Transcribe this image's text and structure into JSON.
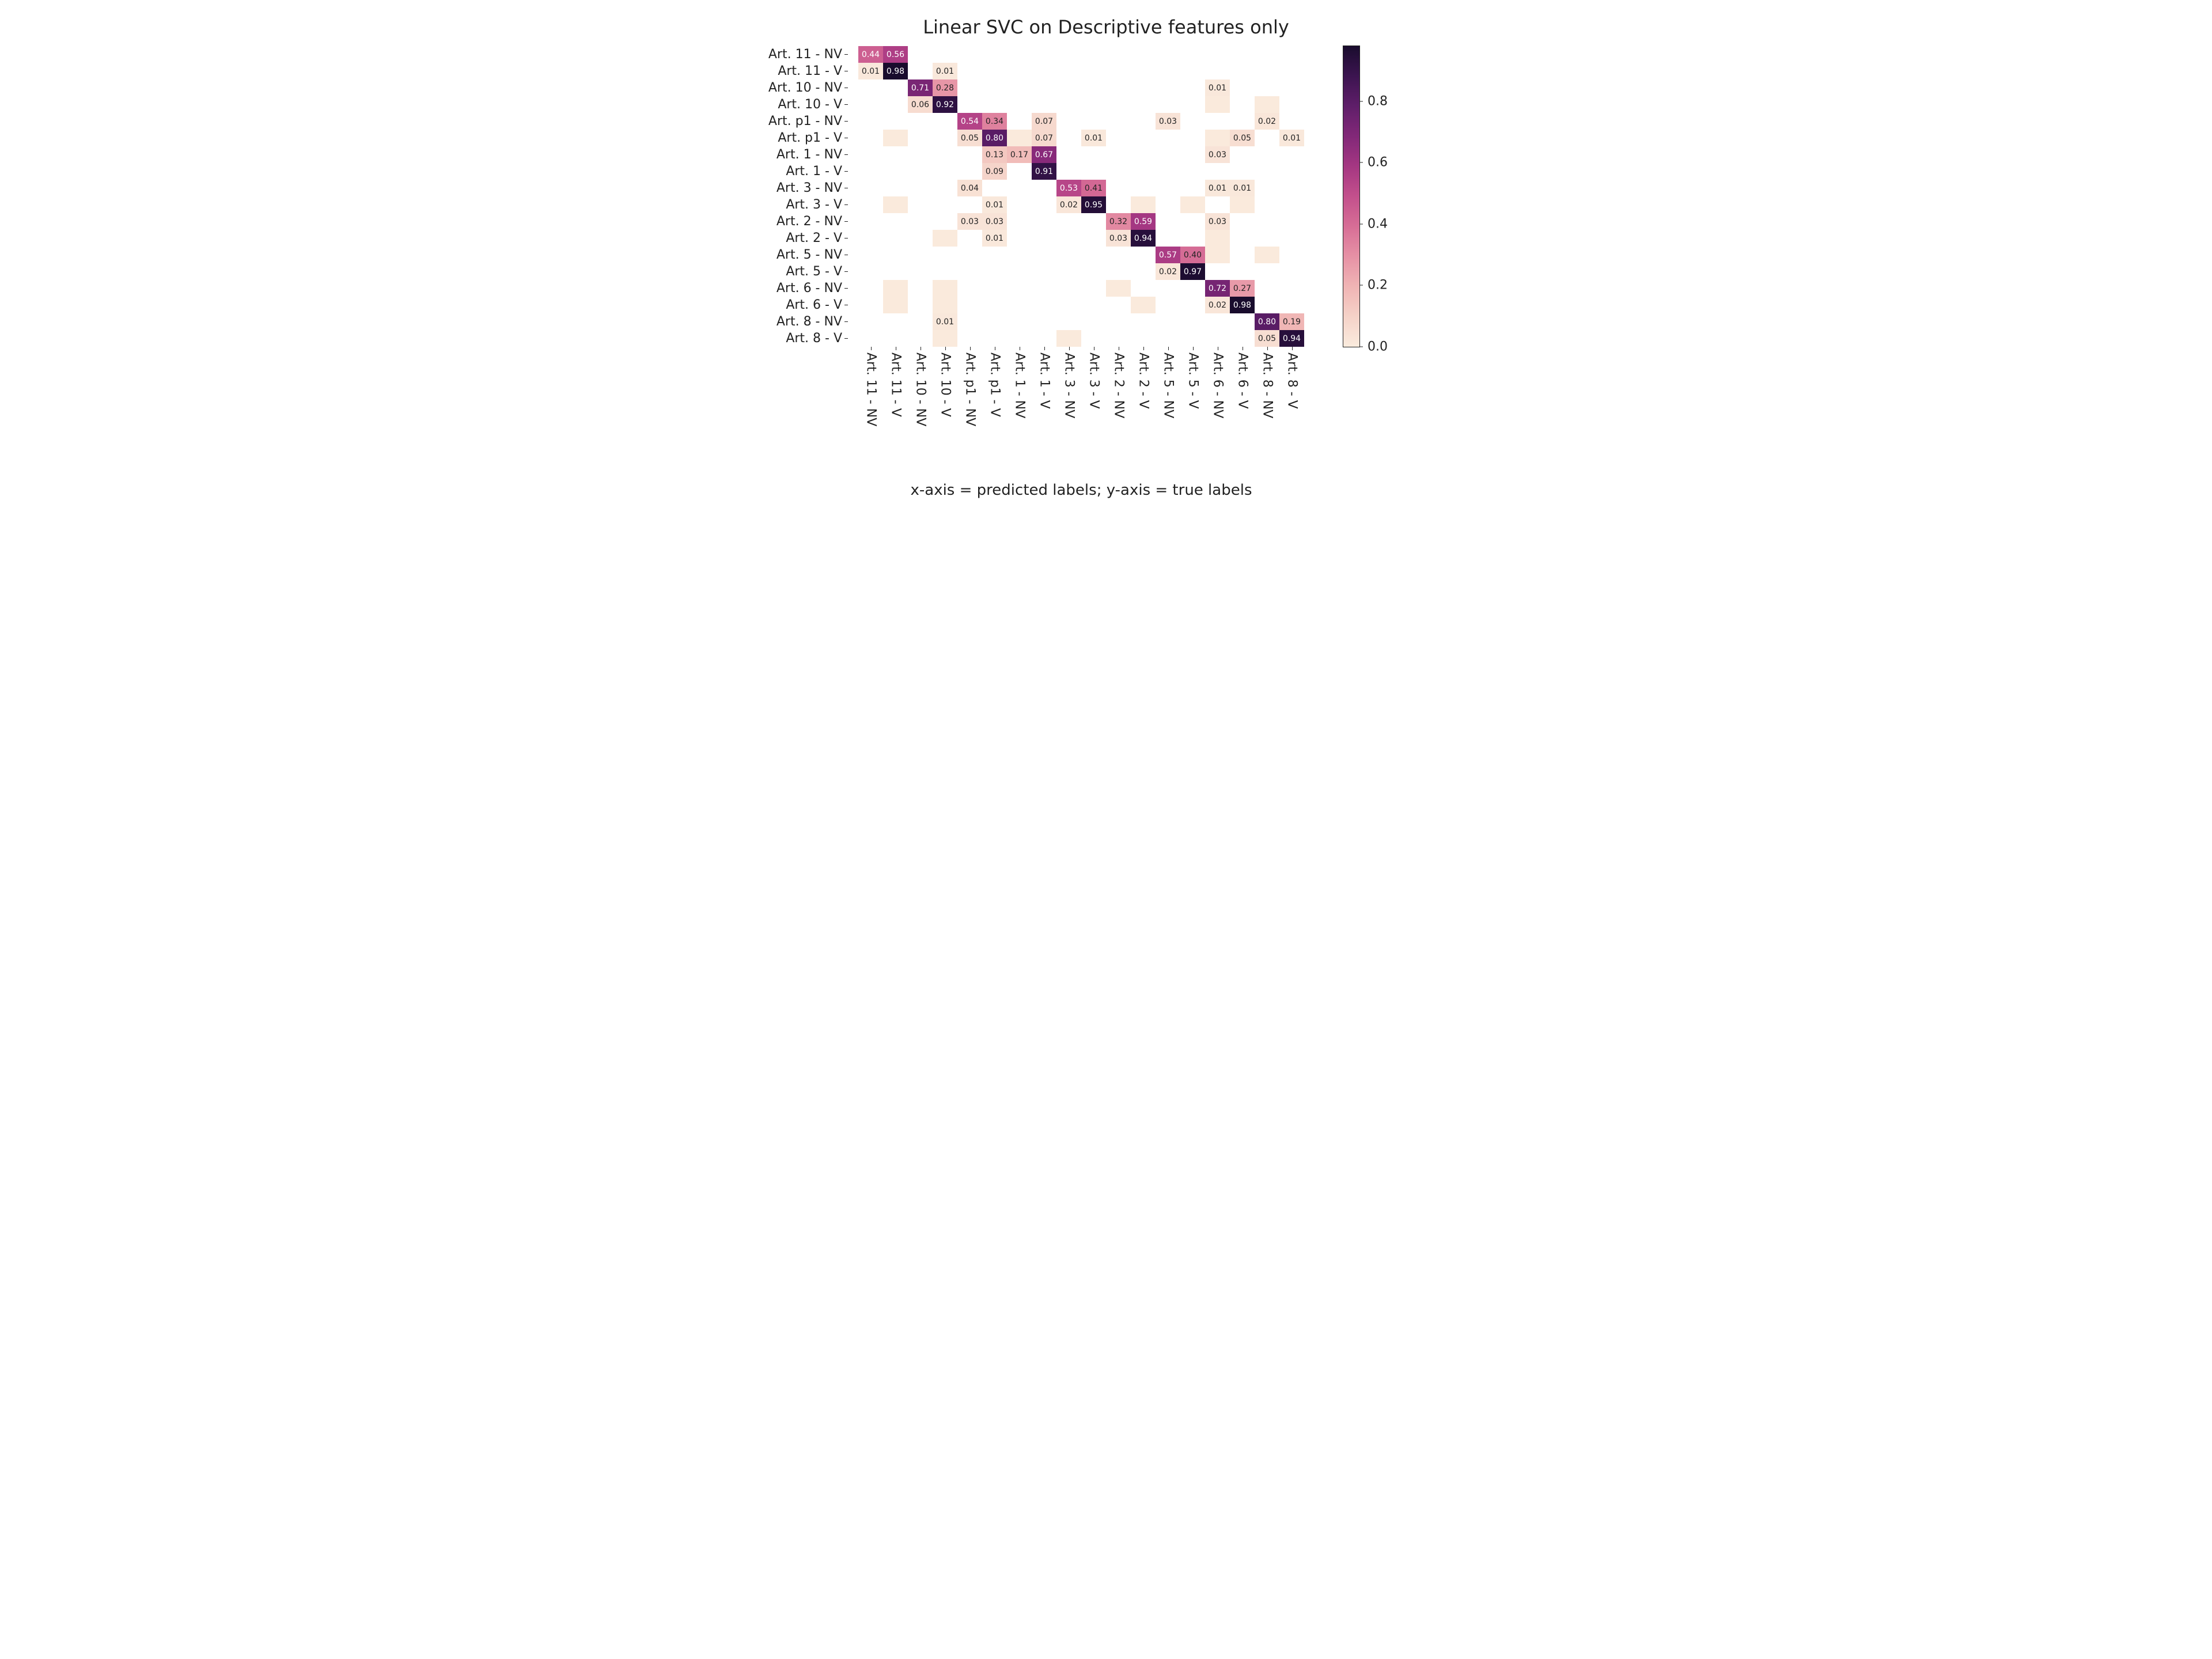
{
  "chart_data": {
    "type": "heatmap",
    "title": "Linear SVC on Descriptive features only",
    "xlabel": "x-axis = predicted labels; y-axis = true labels",
    "ylabel": "",
    "labels": [
      "Art. 11 - NV",
      "Art. 11 - V",
      "Art. 10 - NV",
      "Art. 10 - V",
      "Art. p1 - NV",
      "Art. p1 - V",
      "Art. 1 - NV",
      "Art. 1 - V",
      "Art. 3 - NV",
      "Art. 3 - V",
      "Art. 2 - NV",
      "Art. 2 - V",
      "Art. 5 - NV",
      "Art. 5 - V",
      "Art. 6 - NV",
      "Art. 6 - V",
      "Art. 8 - NV",
      "Art. 8 - V"
    ],
    "vmin": 0.0,
    "vmax": 0.98,
    "colorbar_ticks": [
      0.0,
      0.2,
      0.4,
      0.6,
      0.8
    ],
    "matrix": [
      [
        0.44,
        0.56,
        null,
        null,
        null,
        null,
        null,
        null,
        null,
        null,
        null,
        null,
        null,
        null,
        null,
        null,
        null,
        null
      ],
      [
        0.01,
        0.98,
        null,
        0.01,
        null,
        null,
        null,
        null,
        null,
        null,
        null,
        null,
        null,
        null,
        null,
        null,
        null,
        null
      ],
      [
        null,
        null,
        0.71,
        0.28,
        null,
        null,
        null,
        null,
        null,
        null,
        null,
        null,
        null,
        null,
        0.01,
        null,
        null,
        null
      ],
      [
        null,
        null,
        0.06,
        0.92,
        null,
        null,
        null,
        null,
        null,
        null,
        null,
        null,
        null,
        null,
        0.004,
        null,
        0.004,
        null
      ],
      [
        null,
        null,
        null,
        null,
        0.54,
        0.34,
        null,
        0.07,
        null,
        null,
        null,
        null,
        0.03,
        null,
        null,
        null,
        0.02,
        null
      ],
      [
        null,
        0.004,
        null,
        null,
        0.05,
        0.8,
        0.004,
        0.07,
        null,
        0.01,
        null,
        null,
        null,
        null,
        0.004,
        0.05,
        null,
        0.01
      ],
      [
        null,
        null,
        null,
        null,
        null,
        0.13,
        0.17,
        0.67,
        null,
        null,
        null,
        null,
        null,
        null,
        0.03,
        null,
        null,
        null
      ],
      [
        null,
        null,
        null,
        null,
        null,
        0.09,
        null,
        0.91,
        null,
        null,
        null,
        null,
        null,
        null,
        null,
        null,
        null,
        null
      ],
      [
        null,
        null,
        null,
        null,
        0.04,
        null,
        null,
        null,
        0.53,
        0.41,
        null,
        null,
        null,
        null,
        0.01,
        0.01,
        null,
        null
      ],
      [
        null,
        0.004,
        null,
        null,
        null,
        0.01,
        null,
        null,
        0.02,
        0.95,
        null,
        0.004,
        null,
        0.004,
        null,
        0.004,
        null,
        null
      ],
      [
        null,
        null,
        null,
        null,
        0.03,
        0.03,
        null,
        null,
        null,
        null,
        0.32,
        0.59,
        null,
        null,
        0.03,
        null,
        null,
        null
      ],
      [
        null,
        null,
        null,
        0.004,
        null,
        0.01,
        null,
        null,
        null,
        null,
        0.03,
        0.94,
        null,
        null,
        0.004,
        null,
        null,
        null
      ],
      [
        null,
        null,
        null,
        null,
        null,
        null,
        null,
        null,
        null,
        null,
        null,
        null,
        0.57,
        0.4,
        0.004,
        null,
        0.004,
        null
      ],
      [
        null,
        null,
        null,
        null,
        null,
        null,
        null,
        null,
        null,
        null,
        null,
        null,
        0.02,
        0.97,
        null,
        null,
        null,
        null
      ],
      [
        null,
        0.004,
        null,
        0.004,
        null,
        null,
        null,
        null,
        null,
        null,
        0.004,
        null,
        null,
        null,
        0.72,
        0.27,
        null,
        null
      ],
      [
        null,
        0.004,
        null,
        0.004,
        null,
        null,
        null,
        null,
        null,
        null,
        null,
        0.004,
        null,
        null,
        0.02,
        0.98,
        null,
        null
      ],
      [
        null,
        null,
        null,
        0.01,
        null,
        null,
        null,
        null,
        null,
        null,
        null,
        null,
        null,
        null,
        null,
        null,
        0.8,
        0.19
      ],
      [
        null,
        null,
        null,
        0.004,
        null,
        null,
        null,
        null,
        0.004,
        null,
        null,
        null,
        null,
        null,
        null,
        null,
        0.05,
        0.94
      ]
    ],
    "cell_text": [
      [
        "0.44",
        "0.56",
        "",
        "",
        "",
        "",
        "",
        "",
        "",
        "",
        "",
        "",
        "",
        "",
        "",
        "",
        "",
        ""
      ],
      [
        "0.01",
        "0.98",
        "",
        "0.01",
        "",
        "",
        "",
        "",
        "",
        "",
        "",
        "",
        "",
        "",
        "",
        "",
        "",
        ""
      ],
      [
        "",
        "",
        "0.71",
        "0.28",
        "",
        "",
        "",
        "",
        "",
        "",
        "",
        "",
        "",
        "",
        "0.01",
        "",
        "",
        ""
      ],
      [
        "",
        "",
        "0.06",
        "0.92",
        "",
        "",
        "",
        "",
        "",
        "",
        "",
        "",
        "",
        "",
        "",
        "",
        "",
        ""
      ],
      [
        "",
        "",
        "",
        "",
        "0.54",
        "0.34",
        "",
        "0.07",
        "",
        "",
        "",
        "",
        "0.03",
        "",
        "",
        "",
        "0.02",
        ""
      ],
      [
        "",
        "",
        "",
        "",
        "0.05",
        "0.80",
        "",
        "0.07",
        "",
        "0.01",
        "",
        "",
        "",
        "",
        "",
        "0.05",
        "",
        "0.01"
      ],
      [
        "",
        "",
        "",
        "",
        "",
        "0.13",
        "0.17",
        "0.67",
        "",
        "",
        "",
        "",
        "",
        "",
        "0.03",
        "",
        "",
        ""
      ],
      [
        "",
        "",
        "",
        "",
        "",
        "0.09",
        "",
        "0.91",
        "",
        "",
        "",
        "",
        "",
        "",
        "",
        "",
        "",
        ""
      ],
      [
        "",
        "",
        "",
        "",
        "0.04",
        "",
        "",
        "",
        "0.53",
        "0.41",
        "",
        "",
        "",
        "",
        "0.01",
        "0.01",
        "",
        ""
      ],
      [
        "",
        "",
        "",
        "",
        "",
        "0.01",
        "",
        "",
        "0.02",
        "0.95",
        "",
        "",
        "",
        "",
        "",
        "",
        "",
        ""
      ],
      [
        "",
        "",
        "",
        "",
        "0.03",
        "0.03",
        "",
        "",
        "",
        "",
        "0.32",
        "0.59",
        "",
        "",
        "0.03",
        "",
        "",
        ""
      ],
      [
        "",
        "",
        "",
        "",
        "",
        "0.01",
        "",
        "",
        "",
        "",
        "0.03",
        "0.94",
        "",
        "",
        "",
        "",
        "",
        ""
      ],
      [
        "",
        "",
        "",
        "",
        "",
        "",
        "",
        "",
        "",
        "",
        "",
        "",
        "0.57",
        "0.40",
        "",
        "",
        "",
        ""
      ],
      [
        "",
        "",
        "",
        "",
        "",
        "",
        "",
        "",
        "",
        "",
        "",
        "",
        "0.02",
        "0.97",
        "",
        "",
        "",
        ""
      ],
      [
        "",
        "",
        "",
        "",
        "",
        "",
        "",
        "",
        "",
        "",
        "",
        "",
        "",
        "",
        "0.72",
        "0.27",
        "",
        ""
      ],
      [
        "",
        "",
        "",
        "",
        "",
        "",
        "",
        "",
        "",
        "",
        "",
        "",
        "",
        "",
        "0.02",
        "0.98",
        "",
        ""
      ],
      [
        "",
        "",
        "",
        "0.01",
        "",
        "",
        "",
        "",
        "",
        "",
        "",
        "",
        "",
        "",
        "",
        "",
        "0.80",
        "0.19"
      ],
      [
        "",
        "",
        "",
        "",
        "",
        "",
        "",
        "",
        "",
        "",
        "",
        "",
        "",
        "",
        "",
        "",
        "0.05",
        "0.94"
      ]
    ]
  }
}
